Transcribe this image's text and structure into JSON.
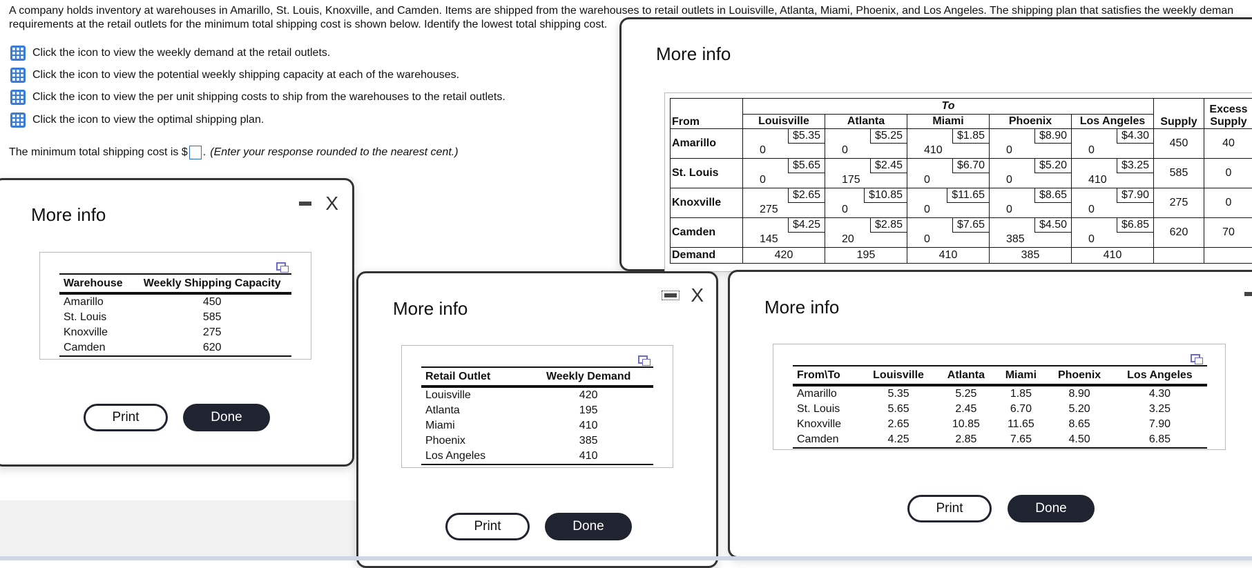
{
  "problem": {
    "line1": "A company holds inventory at warehouses in Amarillo, St. Louis, Knoxville, and Camden. Items are shipped from the warehouses to retail outlets in Louisville, Atlanta, Miami, Phoenix, and Los Angeles. The shipping plan that satisfies the weekly deman",
    "line2": "requirements at the retail outlets for the minimum total shipping cost is shown below. Identify the lowest total shipping cost."
  },
  "hints": [
    {
      "icon": "table-grid-icon",
      "text": "Click the icon to view the weekly demand at the retail outlets."
    },
    {
      "icon": "table-grid-icon",
      "text": "Click the icon to view the potential weekly shipping capacity at each of the warehouses."
    },
    {
      "icon": "table-grid-icon",
      "text": "Click the icon to view the per unit shipping costs to ship from the warehouses to the retail outlets."
    },
    {
      "icon": "table-grid-icon",
      "text": "Click the icon to view the optimal shipping plan."
    }
  ],
  "answer": {
    "prefix": "The minimum total shipping cost is $",
    "value": "",
    "suffix": ".",
    "instruction": "(Enter your response rounded to the nearest cent.)"
  },
  "modals": {
    "title": "More info",
    "print_label": "Print",
    "done_label": "Done",
    "close_glyph": "X"
  },
  "capacity": {
    "headers": [
      "Warehouse",
      "Weekly Shipping Capacity"
    ],
    "rows": [
      [
        "Amarillo",
        "450"
      ],
      [
        "St. Louis",
        "585"
      ],
      [
        "Knoxville",
        "275"
      ],
      [
        "Camden",
        "620"
      ]
    ]
  },
  "demand": {
    "headers": [
      "Retail Outlet",
      "Weekly Demand"
    ],
    "rows": [
      [
        "Louisville",
        "420"
      ],
      [
        "Atlanta",
        "195"
      ],
      [
        "Miami",
        "410"
      ],
      [
        "Phoenix",
        "385"
      ],
      [
        "Los Angeles",
        "410"
      ]
    ]
  },
  "costs": {
    "headers": [
      "From\\To",
      "Louisville",
      "Atlanta",
      "Miami",
      "Phoenix",
      "Los Angeles"
    ],
    "rows": [
      [
        "Amarillo",
        "5.35",
        "5.25",
        "1.85",
        "8.90",
        "4.30"
      ],
      [
        "St. Louis",
        "5.65",
        "2.45",
        "6.70",
        "5.20",
        "3.25"
      ],
      [
        "Knoxville",
        "2.65",
        "10.85",
        "11.65",
        "8.65",
        "7.90"
      ],
      [
        "Camden",
        "4.25",
        "2.85",
        "7.65",
        "4.50",
        "6.85"
      ]
    ]
  },
  "plan": {
    "from_label": "From",
    "to_label": "To",
    "destinations": [
      "Louisville",
      "Atlanta",
      "Miami",
      "Phoenix",
      "Los Angeles"
    ],
    "supply_label": "Supply",
    "excess_label": "Excess Supply",
    "demand_label": "Demand",
    "rows": [
      {
        "from": "Amarillo",
        "cells": [
          {
            "cost": "$5.35",
            "qty": "0"
          },
          {
            "cost": "$5.25",
            "qty": "0"
          },
          {
            "cost": "$1.85",
            "qty": "410"
          },
          {
            "cost": "$8.90",
            "qty": "0"
          },
          {
            "cost": "$4.30",
            "qty": "0"
          }
        ],
        "supply": "450",
        "excess": "40"
      },
      {
        "from": "St. Louis",
        "cells": [
          {
            "cost": "$5.65",
            "qty": "0"
          },
          {
            "cost": "$2.45",
            "qty": "175"
          },
          {
            "cost": "$6.70",
            "qty": "0"
          },
          {
            "cost": "$5.20",
            "qty": "0"
          },
          {
            "cost": "$3.25",
            "qty": "410"
          }
        ],
        "supply": "585",
        "excess": "0"
      },
      {
        "from": "Knoxville",
        "cells": [
          {
            "cost": "$2.65",
            "qty": "275"
          },
          {
            "cost": "$10.85",
            "qty": "0"
          },
          {
            "cost": "$11.65",
            "qty": "0"
          },
          {
            "cost": "$8.65",
            "qty": "0"
          },
          {
            "cost": "$7.90",
            "qty": "0"
          }
        ],
        "supply": "275",
        "excess": "0"
      },
      {
        "from": "Camden",
        "cells": [
          {
            "cost": "$4.25",
            "qty": "145"
          },
          {
            "cost": "$2.85",
            "qty": "20"
          },
          {
            "cost": "$7.65",
            "qty": "0"
          },
          {
            "cost": "$4.50",
            "qty": "385"
          },
          {
            "cost": "$6.85",
            "qty": "0"
          }
        ],
        "supply": "620",
        "excess": "70"
      }
    ],
    "demand": [
      "420",
      "195",
      "410",
      "385",
      "410"
    ]
  }
}
